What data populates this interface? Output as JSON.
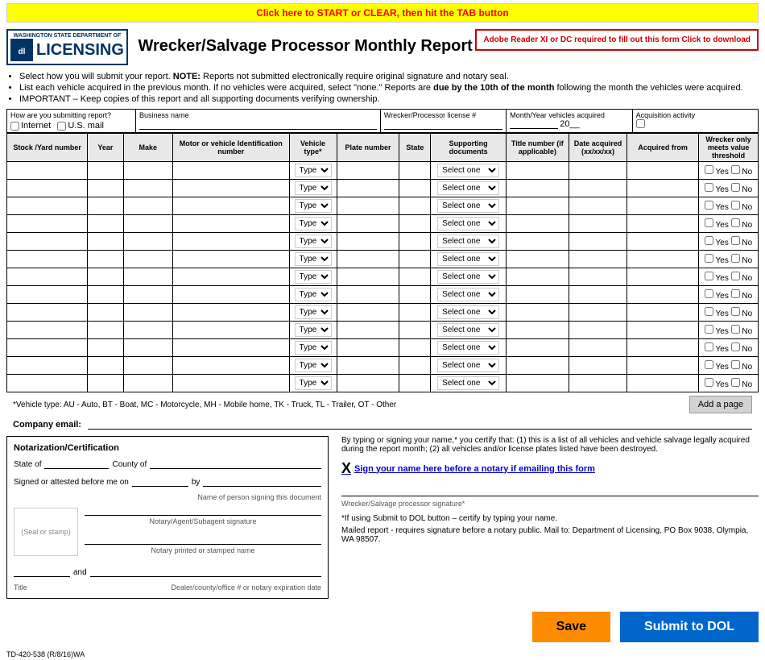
{
  "topBar": {
    "label": "Click here to START or CLEAR, then hit the TAB button"
  },
  "header": {
    "logoState": "WASHINGTON STATE DEPARTMENT OF",
    "logoTitle": "LICENSING",
    "title": "Wrecker/Salvage Processor Monthly Report",
    "adobeNote": "Adobe Reader XI or DC required to fill out this form Click to download"
  },
  "instructions": [
    "Select how you will submit your report. NOTE: Reports not submitted electronically require original signature and notary seal.",
    "List each vehicle acquired in the previous month. If no vehicles were acquired, select \"none.\" Reports are due by the 10th of the month following the month the vehicles were acquired.",
    "IMPORTANT – Keep copies of this report and all supporting documents verifying ownership."
  ],
  "topFields": {
    "submitLabel": "How are you submitting report?",
    "internetLabel": "Internet",
    "mailLabel": "U.S. mail",
    "businessLabel": "Business name",
    "licenseLabel": "Wrecker/Processor license #",
    "monthYearLabel": "Month/Year vehicles acquired",
    "monthYearSuffix": "20__",
    "acquisitionLabel": "Acquisition activity"
  },
  "tableHeaders": {
    "stock": "Stock /Yard number",
    "year": "Year",
    "make": "Make",
    "motor": "Motor or vehicle Identification number",
    "vtype": "Vehicle type*",
    "plate": "Plate number",
    "state": "State",
    "docs": "Supporting documents",
    "title": "Title number (if applicable)",
    "date": "Date acquired (xx/xx/xx)",
    "from": "Acquired from",
    "wrecker": "Wrecker only meets value threshold"
  },
  "rows": [
    {
      "vtype": "Type",
      "docs": "Select one",
      "wrecker": "Yes  No"
    },
    {
      "vtype": "Type",
      "docs": "Select one",
      "wrecker": "Yes  No"
    },
    {
      "vtype": "Type",
      "docs": "Select one",
      "wrecker": "Yes  No"
    },
    {
      "vtype": "Type",
      "docs": "Select one",
      "wrecker": "Yes  No"
    },
    {
      "vtype": "Type",
      "docs": "Select one",
      "wrecker": "Yes  No"
    },
    {
      "vtype": "Type",
      "docs": "Select one",
      "wrecker": "Yes  No"
    },
    {
      "vtype": "Type",
      "docs": "Select one",
      "wrecker": "Yes  No"
    },
    {
      "vtype": "Type",
      "docs": "Select one",
      "wrecker": "Yes  No"
    },
    {
      "vtype": "Type",
      "docs": "Select one",
      "wrecker": "Yes  No"
    },
    {
      "vtype": "Type",
      "docs": "Select one",
      "wrecker": "Yes  No"
    },
    {
      "vtype": "Type",
      "docs": "Select one",
      "wrecker": "Yes  No"
    },
    {
      "vtype": "Type",
      "docs": "Select one",
      "wrecker": "Yes  No"
    },
    {
      "vtype": "Type",
      "docs": "Select one",
      "wrecker": "Yes  No"
    }
  ],
  "vehicleTypeNote": "*Vehicle type: AU - Auto, BT - Boat, MC - Motorcycle, MH - Mobile home, TK - Truck, TL - Trailer, OT - Other",
  "addPageBtn": "Add a page",
  "companyEmail": {
    "label": "Company email:"
  },
  "notarization": {
    "title": "Notarization/Certification",
    "stateLabel": "State of",
    "countyLabel": "County of",
    "signedLabel": "Signed or attested before me on",
    "byLabel": "by",
    "nameLabel": "Name of person signing this document",
    "notaryAgentLabel": "Notary/Agent/Subagent signature",
    "notaryPrintedLabel": "Notary printed or stamped name",
    "sealLabel": "(Seal or stamp)",
    "andLabel": "and",
    "titleLabel": "Title",
    "dealerLabel": "Dealer/county/office # or notary expiration date"
  },
  "certification": {
    "text": "By typing or signing your name,* you certify that: (1) this is a list of all vehicles and vehicle salvage legally acquired during the report month; (2) all vehicles and/or license plates listed have been destroyed.",
    "signHere": "Sign your name here before a notary if emailing this form",
    "signatureLabel": "Wrecker/Salvage processor signature*",
    "noteText": "*If using Submit to DOL button – certify by typing your name.",
    "mailedNote": "Mailed report - requires signature before a notary public. Mail to: Department of Licensing, PO Box 9038, Olympia, WA 98507."
  },
  "buttons": {
    "save": "Save",
    "submit": "Submit to DOL"
  },
  "formId": "TD-420-538 (R/8/16)WA"
}
